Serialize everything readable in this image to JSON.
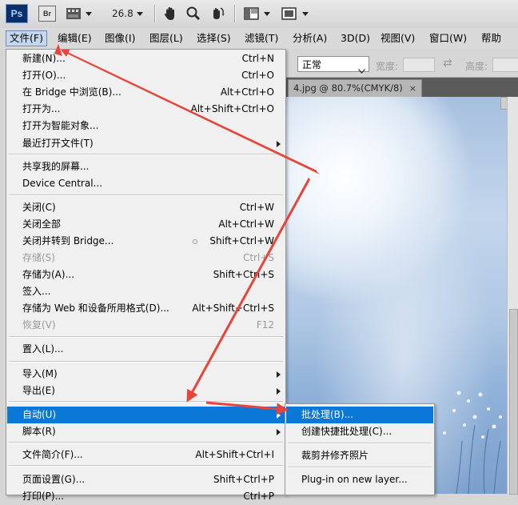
{
  "appbar": {
    "logo": "Ps",
    "bridge": "Br",
    "zoom_value": "26.8",
    "icons": [
      "photoshop-logo",
      "bridge-button",
      "filmstrip-icon",
      "hand-tool-icon",
      "zoom-tool-icon",
      "rotate-view-icon",
      "arrange-documents-icon",
      "screen-mode-icon"
    ]
  },
  "menubar": {
    "items": [
      "文件(F)",
      "编辑(E)",
      "图像(I)",
      "图层(L)",
      "选择(S)",
      "滤镜(T)",
      "分析(A)",
      "3D(D)",
      "视图(V)",
      "窗口(W)",
      "帮助(H)"
    ]
  },
  "options": {
    "mode": "正常",
    "width_label": "宽度:",
    "height_label": "高度:"
  },
  "document": {
    "tab_title": "4.jpg @ 80.7%(CMYK/8)",
    "close": "×"
  },
  "file_menu": {
    "items": [
      {
        "label": "新建(N)...",
        "shortcut": "Ctrl+N"
      },
      {
        "label": "打开(O)...",
        "shortcut": "Ctrl+O"
      },
      {
        "label": "在 Bridge 中浏览(B)...",
        "shortcut": "Alt+Ctrl+O"
      },
      {
        "label": "打开为...",
        "shortcut": "Alt+Shift+Ctrl+O"
      },
      {
        "label": "打开为智能对象...",
        "shortcut": ""
      },
      {
        "label": "最近打开文件(T)",
        "shortcut": ""
      },
      {
        "label": "共享我的屏幕...",
        "shortcut": ""
      },
      {
        "label": "Device Central...",
        "shortcut": ""
      },
      {
        "label": "关闭(C)",
        "shortcut": "Ctrl+W"
      },
      {
        "label": "关闭全部",
        "shortcut": "Alt+Ctrl+W"
      },
      {
        "label": "关闭并转到 Bridge...",
        "shortcut": "Shift+Ctrl+W"
      },
      {
        "label": "存储(S)",
        "shortcut": "Ctrl+S"
      },
      {
        "label": "存储为(A)...",
        "shortcut": "Shift+Ctrl+S"
      },
      {
        "label": "签入...",
        "shortcut": ""
      },
      {
        "label": "存储为 Web 和设备所用格式(D)...",
        "shortcut": "Alt+Shift+Ctrl+S"
      },
      {
        "label": "恢复(V)",
        "shortcut": "F12"
      },
      {
        "label": "置入(L)...",
        "shortcut": ""
      },
      {
        "label": "导入(M)",
        "shortcut": ""
      },
      {
        "label": "导出(E)",
        "shortcut": ""
      },
      {
        "label": "自动(U)",
        "shortcut": ""
      },
      {
        "label": "脚本(R)",
        "shortcut": ""
      },
      {
        "label": "文件简介(F)...",
        "shortcut": "Alt+Shift+Ctrl+I"
      },
      {
        "label": "页面设置(G)...",
        "shortcut": "Shift+Ctrl+P"
      },
      {
        "label": "打印(P)...",
        "shortcut": "Ctrl+P"
      }
    ]
  },
  "submenu": {
    "items": [
      "批处理(B)...",
      "创建快捷批处理(C)...",
      "裁剪并修齐照片",
      "Plug-in on new layer..."
    ]
  },
  "colors": {
    "highlight": "#0a78d7",
    "annotation_arrow": "#e8443a",
    "ps_logo_bg": "#0b2f6b"
  }
}
